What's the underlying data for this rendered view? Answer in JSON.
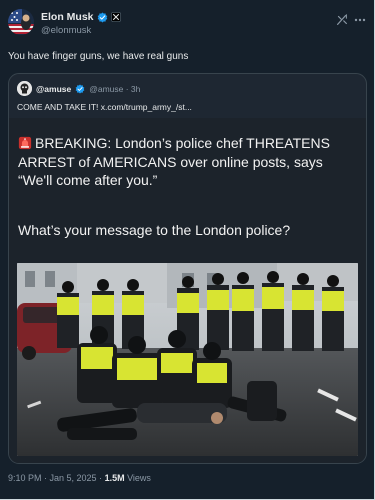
{
  "post": {
    "author": {
      "name": "Elon Musk",
      "handle": "@elonmusk",
      "verified": true,
      "avatar_icon": "avatar-american-flag"
    },
    "text": "You have finger guns, we have real guns",
    "timestamp": "9:10 PM · Jan 5, 2025 · ",
    "views_count": "1.5M",
    "views_label": " Views"
  },
  "quote": {
    "author": {
      "name": "@amuse",
      "handle": "@amuse · 3h",
      "verified": true
    },
    "text": "COME AND TAKE IT! x.com/trump_army_/st...",
    "card": {
      "headline": "BREAKING: London’s police chef THREATENS ARREST of AMERICANS over online posts, says “We'll come after you.”",
      "question": "What’s your message to the London police?",
      "icon": "siren-icon",
      "image": "police-officers-arrest-photo"
    }
  },
  "colors": {
    "background": "#15202b",
    "verified_blue": "#1d9bf0",
    "text": "#e7e9ea",
    "muted": "#8b98a5",
    "police_hiviz": "#d8e432"
  }
}
